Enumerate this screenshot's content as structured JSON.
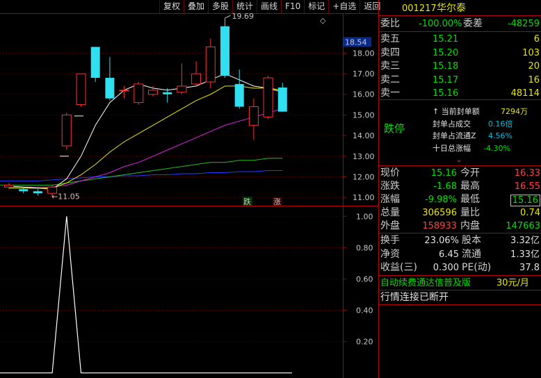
{
  "toolbar": [
    "复权",
    "叠加",
    "多股",
    "统计",
    "画线",
    "F10",
    "标记",
    "+自选",
    "返回"
  ],
  "stock": {
    "code": "001217",
    "name": "华尔泰"
  },
  "weibi": {
    "label": "委比",
    "value": "-100.00%",
    "label2": "委差",
    "value2": "-48259"
  },
  "sell_orders": [
    {
      "label": "卖五",
      "price": "15.21",
      "volume": "6"
    },
    {
      "label": "卖四",
      "price": "15.20",
      "volume": "103"
    },
    {
      "label": "卖三",
      "price": "15.18",
      "volume": "20"
    },
    {
      "label": "卖二",
      "price": "15.17",
      "volume": "16"
    },
    {
      "label": "卖一",
      "price": "15.16",
      "volume": "48114"
    }
  ],
  "limit": {
    "status": "跌停",
    "items": [
      {
        "label": "当前封单额",
        "value": "7294万"
      },
      {
        "label": "封单占成交",
        "value": "0.16倍"
      },
      {
        "label": "封单占流通Z",
        "value": "4.56%"
      },
      {
        "label": "十日总涨幅",
        "value": "-4.30%"
      }
    ]
  },
  "quote": {
    "xianjia": {
      "label": "现价",
      "value": "15.16"
    },
    "jinkai": {
      "label": "今开",
      "value": "16.33"
    },
    "zhangdie": {
      "label": "涨跌",
      "value": "-1.68"
    },
    "zuigao": {
      "label": "最高",
      "value": "16.55"
    },
    "zhangfu": {
      "label": "涨幅",
      "value": "-9.98%"
    },
    "zuidi": {
      "label": "最低",
      "value": "15.16"
    },
    "zongliang": {
      "label": "总量",
      "value": "306596"
    },
    "liangbi": {
      "label": "量比",
      "value": "0.74"
    },
    "waipan": {
      "label": "外盘",
      "value": "158933"
    },
    "neipan": {
      "label": "内盘",
      "value": "147663"
    }
  },
  "fundamentals": {
    "huanshou": {
      "label": "换手",
      "value": "23.06%"
    },
    "guben": {
      "label": "股本",
      "value": "3.32亿"
    },
    "jingzi": {
      "label": "净资",
      "value": "6.45"
    },
    "liutong": {
      "label": "流通",
      "value": "1.33亿"
    },
    "shouyi": {
      "label": "收益(三)",
      "value": "0.300"
    },
    "pe": {
      "label": "PE(动)",
      "value": "37.8"
    }
  },
  "ad": {
    "text": "自动续费通达信普及版",
    "price": "30元/月"
  },
  "status": "行情连接已断开",
  "chart": {
    "price_ticks": [
      "18.00",
      "17.00",
      "16.00",
      "15.00",
      "14.00",
      "13.00",
      "12.00",
      "11.00"
    ],
    "current_price": "18.54",
    "high_label": "19.69",
    "low_label": "11.05",
    "marker_down": "跌",
    "marker_up": "涨",
    "indicator_ticks": [
      "1.00",
      "0.80",
      "0.60",
      "0.40",
      "0.20"
    ]
  },
  "chart_data": {
    "type": "candlestick",
    "ylim": [
      10.6,
      19.9
    ],
    "candles": [
      {
        "o": 11.5,
        "c": 11.6,
        "h": 11.7,
        "l": 11.4
      },
      {
        "o": 11.4,
        "c": 11.3,
        "h": 11.5,
        "l": 11.2
      },
      {
        "o": 11.3,
        "c": 11.2,
        "h": 11.4,
        "l": 11.1
      },
      {
        "o": 11.2,
        "c": 11.5,
        "h": 11.6,
        "l": 11.05
      },
      {
        "o": 13.5,
        "c": 15.0,
        "h": 15.1,
        "l": 13.3
      },
      {
        "o": 15.5,
        "c": 17.0,
        "h": 17.0,
        "l": 15.4
      },
      {
        "o": 18.3,
        "c": 16.8,
        "h": 18.3,
        "l": 16.6
      },
      {
        "o": 16.8,
        "c": 15.8,
        "h": 17.8,
        "l": 15.7
      },
      {
        "o": 16.2,
        "c": 16.2,
        "h": 16.4,
        "l": 15.8
      },
      {
        "o": 15.6,
        "c": 16.5,
        "h": 16.6,
        "l": 15.5
      },
      {
        "o": 16.0,
        "c": 16.2,
        "h": 16.4,
        "l": 15.9
      },
      {
        "o": 16.1,
        "c": 16.0,
        "h": 16.3,
        "l": 15.6
      },
      {
        "o": 16.1,
        "c": 16.4,
        "h": 17.5,
        "l": 16.0
      },
      {
        "o": 16.5,
        "c": 17.0,
        "h": 17.6,
        "l": 16.4
      },
      {
        "o": 16.6,
        "c": 18.3,
        "h": 18.7,
        "l": 16.3
      },
      {
        "o": 19.3,
        "c": 16.9,
        "h": 19.69,
        "l": 16.8
      },
      {
        "o": 16.5,
        "c": 15.4,
        "h": 17.2,
        "l": 15.3
      },
      {
        "o": 14.5,
        "c": 15.4,
        "h": 15.8,
        "l": 13.8
      },
      {
        "o": 14.9,
        "c": 16.8,
        "h": 16.9,
        "l": 14.8
      },
      {
        "o": 16.33,
        "c": 15.16,
        "h": 16.55,
        "l": 15.16
      }
    ],
    "ma_white": [
      11.55,
      11.5,
      11.45,
      11.4,
      11.9,
      13.0,
      14.5,
      15.6,
      16.2,
      16.5,
      16.3,
      16.2,
      16.3,
      16.4,
      16.7,
      17.0,
      16.7,
      16.4,
      16.3,
      16.1
    ],
    "ma_yellow": [
      11.45,
      11.45,
      11.45,
      11.45,
      11.7,
      12.1,
      12.6,
      13.2,
      13.7,
      14.1,
      14.5,
      14.9,
      15.3,
      15.7,
      16.0,
      16.4,
      16.4,
      16.3,
      16.3,
      16.2
    ],
    "ma_magenta": [
      11.5,
      11.5,
      11.5,
      11.5,
      11.6,
      11.8,
      12.0,
      12.2,
      12.5,
      12.7,
      13.0,
      13.3,
      13.6,
      13.9,
      14.2,
      14.5,
      14.7,
      14.9,
      15.1,
      15.3
    ],
    "ma_green": [
      11.6,
      11.6,
      11.6,
      11.6,
      11.7,
      11.8,
      11.9,
      12.0,
      12.1,
      12.2,
      12.3,
      12.4,
      12.5,
      12.6,
      12.7,
      12.7,
      12.8,
      12.8,
      12.9,
      12.9
    ],
    "ma_blue": [
      11.8,
      11.8,
      11.8,
      11.85,
      11.9,
      11.95,
      12.0,
      12.0,
      12.05,
      12.05,
      12.1,
      12.1,
      12.15,
      12.15,
      12.2,
      12.2,
      12.25,
      12.25,
      12.3,
      12.3
    ],
    "indicator": {
      "ylim": [
        0,
        1.05
      ],
      "spike_index": 4,
      "spike_value": 1.0
    }
  }
}
